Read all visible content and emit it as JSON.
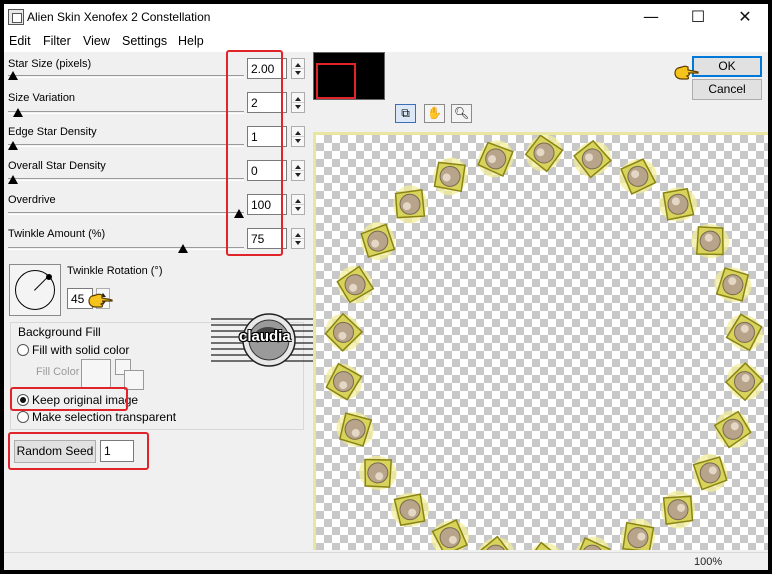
{
  "window": {
    "title": "Alien Skin Xenofex 2 Constellation"
  },
  "controls": {
    "minimize": "—",
    "maximize": "☐",
    "close": "✕"
  },
  "menu": [
    "Edit",
    "Filter",
    "View",
    "Settings",
    "Help"
  ],
  "params": [
    {
      "label": "Star Size (pixels)",
      "value": "2.00",
      "level": 0.0
    },
    {
      "label": "Size Variation",
      "value": "2",
      "level": 0.02
    },
    {
      "label": "Edge Star Density",
      "value": "1",
      "level": 0.0
    },
    {
      "label": "Overall Star Density",
      "value": "0",
      "level": 0.0
    },
    {
      "label": "Overdrive",
      "value": "100",
      "level": 1.0
    },
    {
      "label": "Twinkle Amount (%)",
      "value": "75",
      "level": 0.75
    }
  ],
  "rotation": {
    "label": "Twinkle Rotation (°)",
    "value": "45"
  },
  "background_fill": {
    "title": "Background Fill",
    "option_solid": "Fill with solid color",
    "fill_color_label": "Fill Color",
    "option_keep": "Keep original image",
    "option_transparent": "Make selection transparent",
    "selected": "keep"
  },
  "random_seed": {
    "label": "Random Seed",
    "value": "1"
  },
  "buttons": {
    "ok": "OK",
    "cancel": "Cancel"
  },
  "tools": [
    "compare-icon",
    "hand-icon",
    "magnifier-icon"
  ],
  "status": {
    "zoom": "100%"
  },
  "watermark": {
    "text": "claudia"
  },
  "colors": {
    "highlight": "#e0242a",
    "frame": "#e9e6a0",
    "accent": "#0078d7"
  }
}
